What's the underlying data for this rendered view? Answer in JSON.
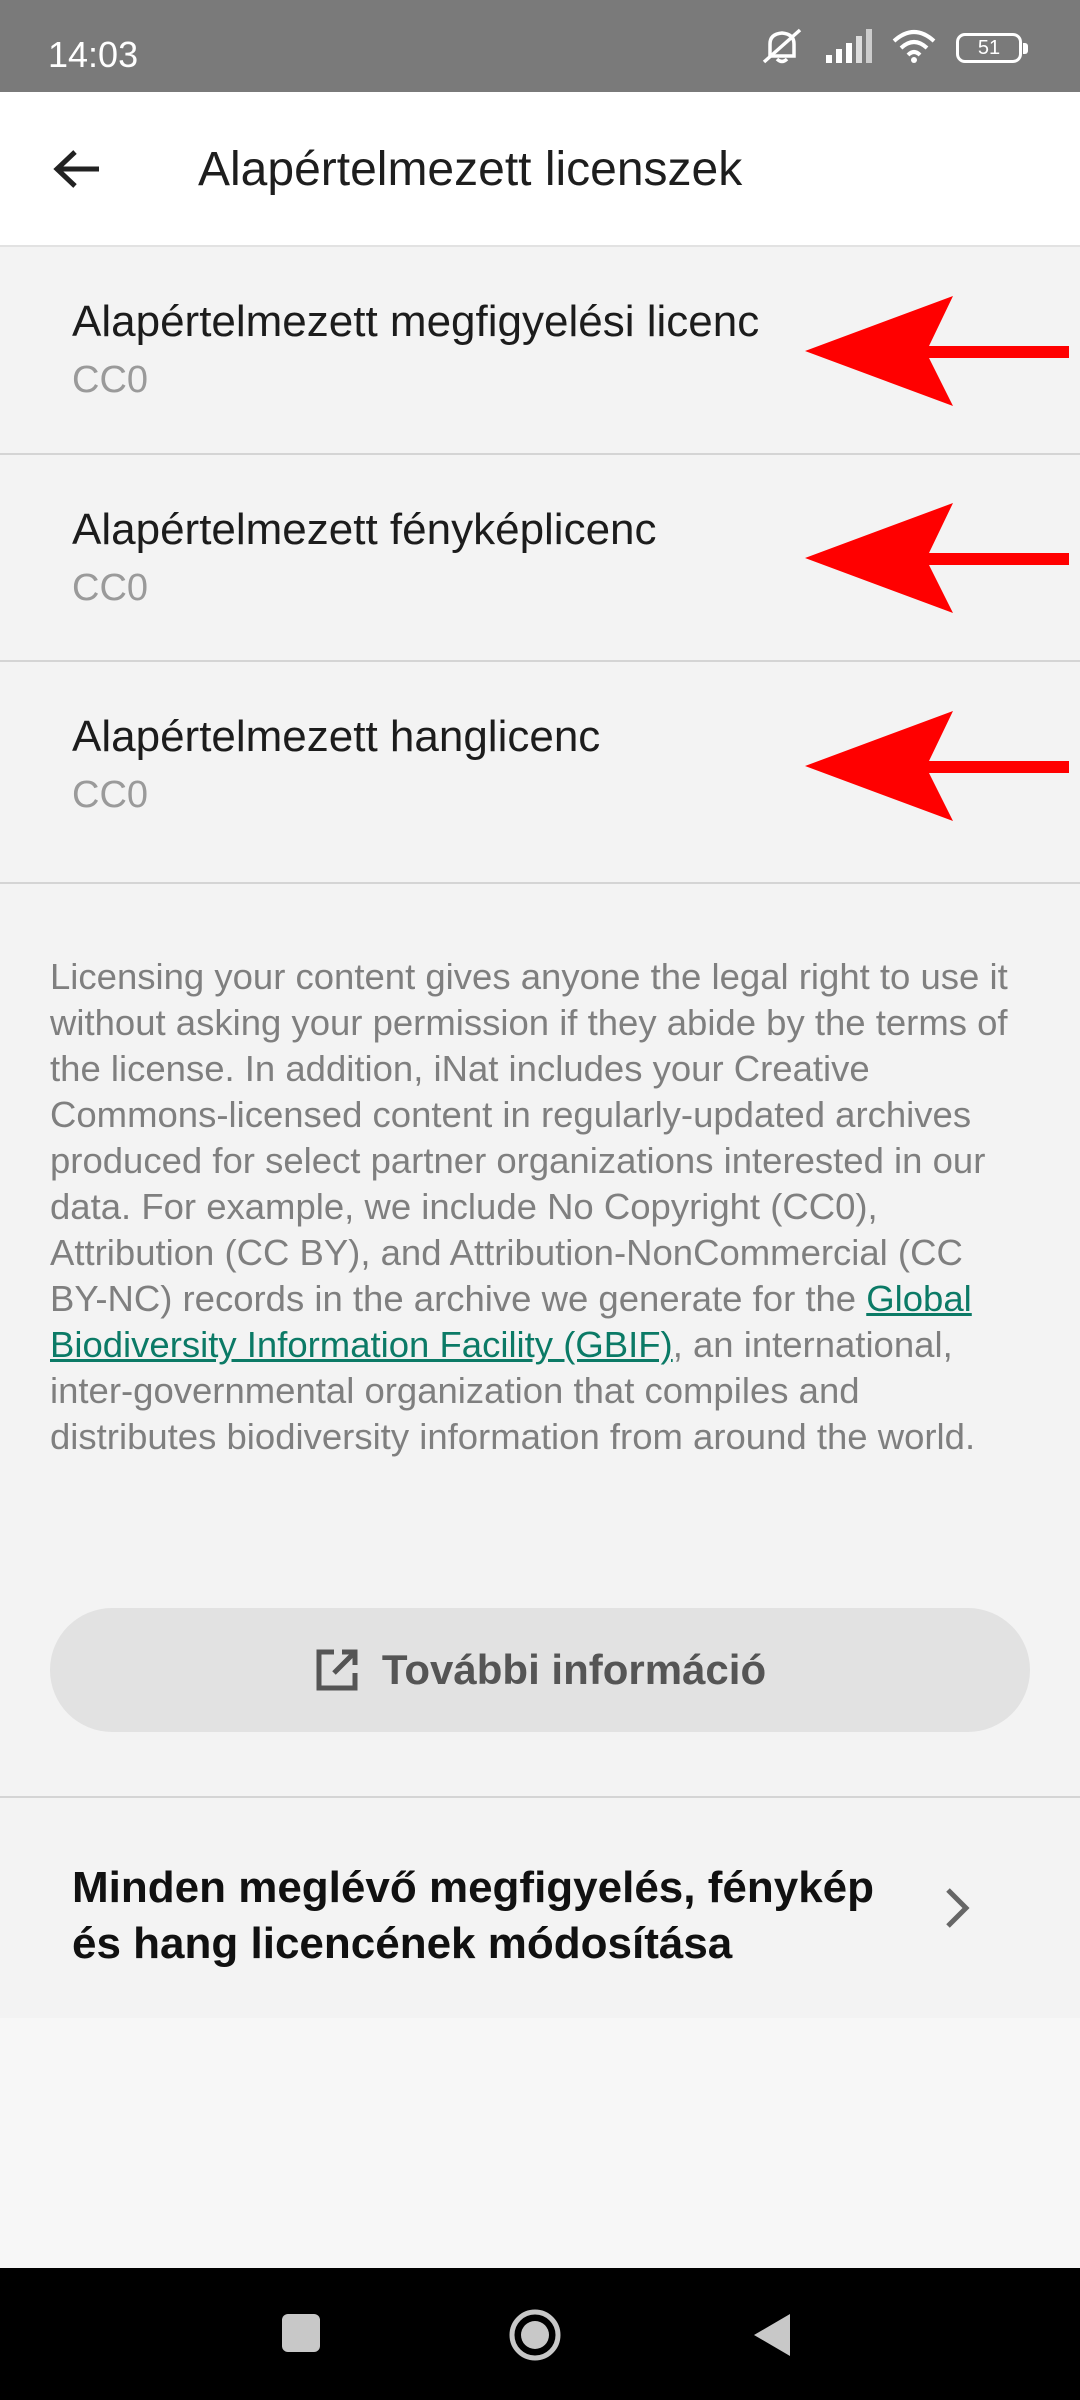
{
  "status_bar": {
    "time": "14:03",
    "battery": "51"
  },
  "header": {
    "title": "Alapértelmezett licenszek"
  },
  "licenses": [
    {
      "title": "Alapértelmezett megfigyelési licenc",
      "value": "CC0"
    },
    {
      "title": "Alapértelmezett fényképlicenc",
      "value": "CC0"
    },
    {
      "title": "Alapértelmezett hanglicenc",
      "value": "CC0"
    }
  ],
  "description": {
    "part1": "Licensing your content gives anyone the legal right to use it without asking your permission if they abide by the terms of the license. In addition, iNat includes your Creative Commons-licensed content in regularly-updated archives produced for select partner organizations interested in our data. For example, we include No Copyright (CC0), Attribution (CC BY), and Attribution-NonCommercial (CC BY-NC) records in the archive we generate for the ",
    "link": "Global Biodiversity Information Facility (GBIF)",
    "part2": ", an international, inter-governmental organization that compiles and distributes biodiversity information from around the world."
  },
  "more_button": {
    "label": "További információ",
    "icon": "open-external-icon"
  },
  "change_all": {
    "label": "Minden meglévő megfigyelés, fénykép és hang licencének módosítása",
    "icon": "chevron-right-icon"
  },
  "colors": {
    "arrow": "#ff0000",
    "link": "#0b7a66",
    "status_bar": "#7a7a7a"
  }
}
